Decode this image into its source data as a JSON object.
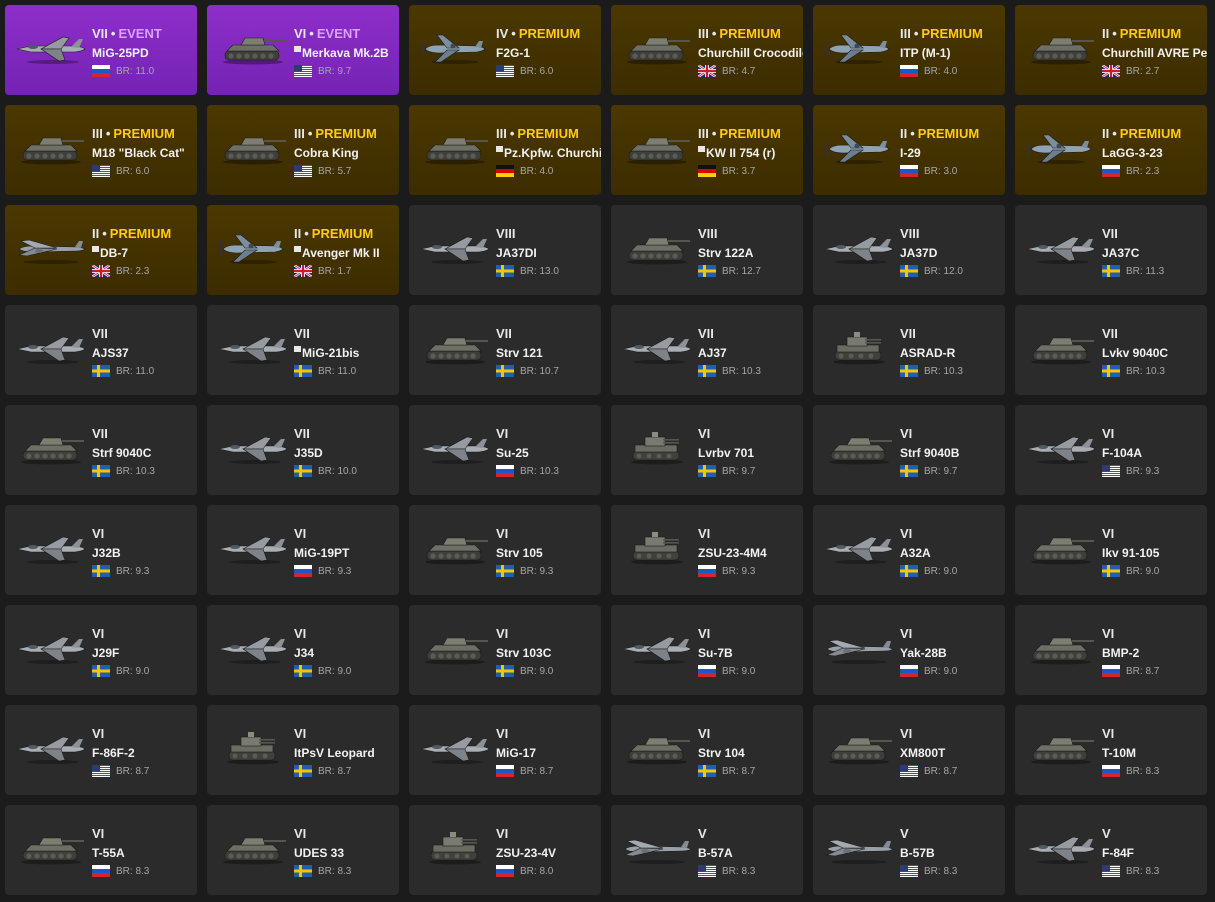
{
  "colors": {
    "page_bg": "#1b1b1b",
    "card_bg": "#2b2b2b",
    "event": "#8e2ec9",
    "premium": "#4b3800",
    "premium_label": "#ffcc14"
  },
  "labels": {
    "premium": "PREMIUM",
    "event": "EVENT",
    "separator": "•"
  },
  "vehicles": [
    {
      "rank": "VII",
      "kind": "event",
      "name": "MiG-25PD",
      "nation": "ussr",
      "br": "BR: 11.0",
      "type": "jet",
      "box": false
    },
    {
      "rank": "VI",
      "kind": "event",
      "name": "Merkava Mk.2B",
      "nation": "usa",
      "br": "BR: 9.7",
      "type": "tank",
      "box": true
    },
    {
      "rank": "IV",
      "kind": "premium",
      "name": "F2G-1",
      "nation": "usa",
      "br": "BR: 6.0",
      "type": "prop",
      "box": false
    },
    {
      "rank": "III",
      "kind": "premium",
      "name": "Churchill Crocodile",
      "nation": "uk",
      "br": "BR: 4.7",
      "type": "tank",
      "box": false
    },
    {
      "rank": "III",
      "kind": "premium",
      "name": "ITP (M-1)",
      "nation": "ussr",
      "br": "BR: 4.0",
      "type": "prop",
      "box": false
    },
    {
      "rank": "II",
      "kind": "premium",
      "name": "Churchill AVRE Petard",
      "nation": "uk",
      "br": "BR: 2.7",
      "type": "tank",
      "box": false
    },
    {
      "rank": "III",
      "kind": "premium",
      "name": "M18 \"Black Cat\"",
      "nation": "usa",
      "br": "BR: 6.0",
      "type": "tank",
      "box": false
    },
    {
      "rank": "III",
      "kind": "premium",
      "name": "Cobra King",
      "nation": "usa",
      "br": "BR: 5.7",
      "type": "tank",
      "box": false
    },
    {
      "rank": "III",
      "kind": "premium",
      "name": "Pz.Kpfw. Churchill",
      "nation": "germany",
      "br": "BR: 4.0",
      "type": "tank",
      "box": true
    },
    {
      "rank": "III",
      "kind": "premium",
      "name": "KW II 754 (r)",
      "nation": "germany",
      "br": "BR: 3.7",
      "type": "tank",
      "box": true
    },
    {
      "rank": "II",
      "kind": "premium",
      "name": "I-29",
      "nation": "ussr",
      "br": "BR: 3.0",
      "type": "prop",
      "box": false
    },
    {
      "rank": "II",
      "kind": "premium",
      "name": "LaGG-3-23",
      "nation": "ussr",
      "br": "BR: 2.3",
      "type": "prop",
      "box": false
    },
    {
      "rank": "II",
      "kind": "premium",
      "name": "DB-7",
      "nation": "uk",
      "br": "BR: 2.3",
      "type": "bomber",
      "box": true
    },
    {
      "rank": "II",
      "kind": "premium",
      "name": "Avenger Mk II",
      "nation": "uk",
      "br": "BR: 1.7",
      "type": "prop",
      "box": true
    },
    {
      "rank": "VIII",
      "kind": "normal",
      "name": "JA37DI",
      "nation": "sweden",
      "br": "BR: 13.0",
      "type": "jet",
      "box": false
    },
    {
      "rank": "VIII",
      "kind": "normal",
      "name": "Strv 122A",
      "nation": "sweden",
      "br": "BR: 12.7",
      "type": "tank",
      "box": false
    },
    {
      "rank": "VIII",
      "kind": "normal",
      "name": "JA37D",
      "nation": "sweden",
      "br": "BR: 12.0",
      "type": "jet",
      "box": false
    },
    {
      "rank": "VII",
      "kind": "normal",
      "name": "JA37C",
      "nation": "sweden",
      "br": "BR: 11.3",
      "type": "jet",
      "box": false
    },
    {
      "rank": "VII",
      "kind": "normal",
      "name": "AJS37",
      "nation": "sweden",
      "br": "BR: 11.0",
      "type": "jet",
      "box": false
    },
    {
      "rank": "VII",
      "kind": "normal",
      "name": "MiG-21bis",
      "nation": "sweden",
      "br": "BR: 11.0",
      "type": "jet",
      "box": true
    },
    {
      "rank": "VII",
      "kind": "normal",
      "name": "Strv 121",
      "nation": "sweden",
      "br": "BR: 10.7",
      "type": "tank",
      "box": false
    },
    {
      "rank": "VII",
      "kind": "normal",
      "name": "AJ37",
      "nation": "sweden",
      "br": "BR: 10.3",
      "type": "jet",
      "box": false
    },
    {
      "rank": "VII",
      "kind": "normal",
      "name": "ASRAD-R",
      "nation": "sweden",
      "br": "BR: 10.3",
      "type": "spaa",
      "box": false
    },
    {
      "rank": "VII",
      "kind": "normal",
      "name": "Lvkv 9040C",
      "nation": "sweden",
      "br": "BR: 10.3",
      "type": "tank",
      "box": false
    },
    {
      "rank": "VII",
      "kind": "normal",
      "name": "Strf 9040C",
      "nation": "sweden",
      "br": "BR: 10.3",
      "type": "tank",
      "box": false
    },
    {
      "rank": "VII",
      "kind": "normal",
      "name": "J35D",
      "nation": "sweden",
      "br": "BR: 10.0",
      "type": "jet",
      "box": false
    },
    {
      "rank": "VI",
      "kind": "normal",
      "name": "Su-25",
      "nation": "ussr",
      "br": "BR: 10.3",
      "type": "jet",
      "box": false
    },
    {
      "rank": "VI",
      "kind": "normal",
      "name": "Lvrbv 701",
      "nation": "sweden",
      "br": "BR: 9.7",
      "type": "spaa",
      "box": false
    },
    {
      "rank": "VI",
      "kind": "normal",
      "name": "Strf 9040B",
      "nation": "sweden",
      "br": "BR: 9.7",
      "type": "tank",
      "box": false
    },
    {
      "rank": "VI",
      "kind": "normal",
      "name": "F-104A",
      "nation": "usa",
      "br": "BR: 9.3",
      "type": "jet",
      "box": false
    },
    {
      "rank": "VI",
      "kind": "normal",
      "name": "J32B",
      "nation": "sweden",
      "br": "BR: 9.3",
      "type": "jet",
      "box": false
    },
    {
      "rank": "VI",
      "kind": "normal",
      "name": "MiG-19PT",
      "nation": "ussr",
      "br": "BR: 9.3",
      "type": "jet",
      "box": false
    },
    {
      "rank": "VI",
      "kind": "normal",
      "name": "Strv 105",
      "nation": "sweden",
      "br": "BR: 9.3",
      "type": "tank",
      "box": false
    },
    {
      "rank": "VI",
      "kind": "normal",
      "name": "ZSU-23-4M4",
      "nation": "ussr",
      "br": "BR: 9.3",
      "type": "spaa",
      "box": false
    },
    {
      "rank": "VI",
      "kind": "normal",
      "name": "A32A",
      "nation": "sweden",
      "br": "BR: 9.0",
      "type": "jet",
      "box": false
    },
    {
      "rank": "VI",
      "kind": "normal",
      "name": "Ikv 91-105",
      "nation": "sweden",
      "br": "BR: 9.0",
      "type": "tank",
      "box": false
    },
    {
      "rank": "VI",
      "kind": "normal",
      "name": "J29F",
      "nation": "sweden",
      "br": "BR: 9.0",
      "type": "jet",
      "box": false
    },
    {
      "rank": "VI",
      "kind": "normal",
      "name": "J34",
      "nation": "sweden",
      "br": "BR: 9.0",
      "type": "jet",
      "box": false
    },
    {
      "rank": "VI",
      "kind": "normal",
      "name": "Strv 103C",
      "nation": "sweden",
      "br": "BR: 9.0",
      "type": "tank",
      "box": false
    },
    {
      "rank": "VI",
      "kind": "normal",
      "name": "Su-7B",
      "nation": "ussr",
      "br": "BR: 9.0",
      "type": "jet",
      "box": false
    },
    {
      "rank": "VI",
      "kind": "normal",
      "name": "Yak-28B",
      "nation": "ussr",
      "br": "BR: 9.0",
      "type": "bomber",
      "box": false
    },
    {
      "rank": "VI",
      "kind": "normal",
      "name": "BMP-2",
      "nation": "ussr",
      "br": "BR: 8.7",
      "type": "tank",
      "box": false
    },
    {
      "rank": "VI",
      "kind": "normal",
      "name": "F-86F-2",
      "nation": "usa",
      "br": "BR: 8.7",
      "type": "jet",
      "box": false
    },
    {
      "rank": "VI",
      "kind": "normal",
      "name": "ItPsV Leopard",
      "nation": "sweden",
      "br": "BR: 8.7",
      "type": "spaa",
      "box": false
    },
    {
      "rank": "VI",
      "kind": "normal",
      "name": "MiG-17",
      "nation": "ussr",
      "br": "BR: 8.7",
      "type": "jet",
      "box": false
    },
    {
      "rank": "VI",
      "kind": "normal",
      "name": "Strv 104",
      "nation": "sweden",
      "br": "BR: 8.7",
      "type": "tank",
      "box": false
    },
    {
      "rank": "VI",
      "kind": "normal",
      "name": "XM800T",
      "nation": "usa",
      "br": "BR: 8.7",
      "type": "tank",
      "box": false
    },
    {
      "rank": "VI",
      "kind": "normal",
      "name": "T-10M",
      "nation": "ussr",
      "br": "BR: 8.3",
      "type": "tank",
      "box": false
    },
    {
      "rank": "VI",
      "kind": "normal",
      "name": "T-55A",
      "nation": "ussr",
      "br": "BR: 8.3",
      "type": "tank",
      "box": false
    },
    {
      "rank": "VI",
      "kind": "normal",
      "name": "UDES 33",
      "nation": "sweden",
      "br": "BR: 8.3",
      "type": "tank",
      "box": false
    },
    {
      "rank": "VI",
      "kind": "normal",
      "name": "ZSU-23-4V",
      "nation": "ussr",
      "br": "BR: 8.0",
      "type": "spaa",
      "box": false
    },
    {
      "rank": "V",
      "kind": "normal",
      "name": "B-57A",
      "nation": "usa",
      "br": "BR: 8.3",
      "type": "bomber",
      "box": false
    },
    {
      "rank": "V",
      "kind": "normal",
      "name": "B-57B",
      "nation": "usa",
      "br": "BR: 8.3",
      "type": "bomber",
      "box": false
    },
    {
      "rank": "V",
      "kind": "normal",
      "name": "F-84F",
      "nation": "usa",
      "br": "BR: 8.3",
      "type": "jet",
      "box": false
    }
  ]
}
